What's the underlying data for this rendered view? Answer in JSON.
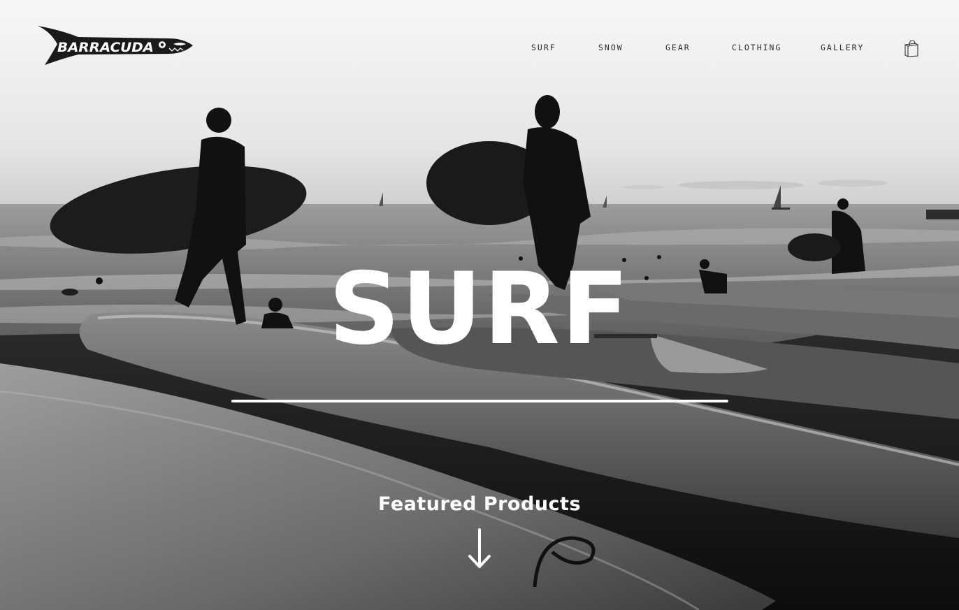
{
  "header": {
    "logo_text": "BARRACUDA",
    "nav": [
      {
        "label": "SURF"
      },
      {
        "label": "SNOW"
      },
      {
        "label": "GEAR"
      },
      {
        "label": "CLOTHING"
      },
      {
        "label": "GALLERY"
      }
    ],
    "cart_icon": "shopping-bag-icon"
  },
  "hero": {
    "title": "SURF",
    "featured_label": "Featured Products",
    "scroll_icon": "arrow-down-icon",
    "image_description_colors": {
      "sky": "#f4f4f4",
      "text": "#ffffff",
      "nav_text": "#2b2b2b"
    }
  }
}
